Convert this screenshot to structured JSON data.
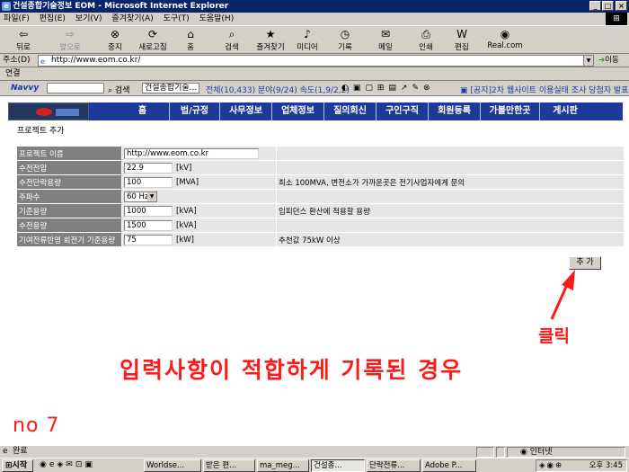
{
  "window": {
    "title": "건설종합기술정보 EOM - Microsoft Internet Explorer"
  },
  "menu": [
    "파일(F)",
    "편집(E)",
    "보기(V)",
    "즐겨찾기(A)",
    "도구(T)",
    "도움말(H)"
  ],
  "toolbar": [
    {
      "label": "뒤로",
      "icon": "back-arrow"
    },
    {
      "label": "앞으로",
      "icon": "forward-arrow"
    },
    {
      "label": "중지",
      "icon": "stop-icon"
    },
    {
      "label": "새로고침",
      "icon": "refresh-icon"
    },
    {
      "label": "홈",
      "icon": "home-icon"
    },
    {
      "label": "검색",
      "icon": "search-icon"
    },
    {
      "label": "즐겨찾기",
      "icon": "favorites-icon"
    },
    {
      "label": "미디어",
      "icon": "media-icon"
    },
    {
      "label": "기록",
      "icon": "history-icon"
    },
    {
      "label": "메일",
      "icon": "mail-icon"
    },
    {
      "label": "인쇄",
      "icon": "print-icon"
    },
    {
      "label": "편집",
      "icon": "edit-icon"
    },
    {
      "label": "Real.com",
      "icon": "real-icon"
    }
  ],
  "address": {
    "label": "주소(D)",
    "url": "http://www.eom.co.kr/",
    "go": "이동"
  },
  "links": {
    "label": "연결"
  },
  "navy": {
    "brand": "Navvy",
    "search_label": "검색",
    "query": "건설종합기술...",
    "results": "전체(10,433)  분야(9/24)  속도(1,9/2,2)",
    "ticker": "[공지]2차 웹사이트 이용실태 조사 당첨자 발표"
  },
  "site_nav": [
    "홈",
    "법/규정",
    "사무정보",
    "업체정보",
    "질의회신",
    "구인구직",
    "회원등록",
    "가볼만한곳",
    "게시판"
  ],
  "form": {
    "section_title": "프로젝트 추가",
    "rows": [
      {
        "label": "프로젝트 이름",
        "value": "http://www.eom.co.kr",
        "unit": "",
        "note": ""
      },
      {
        "label": "수전전압",
        "value": "22.9",
        "unit": "[kV]",
        "note": ""
      },
      {
        "label": "수전단락용량",
        "value": "100",
        "unit": "[MVA]",
        "note": "최소 100MVA, 변전소가 가까운곳은 전기사업자에게 문의"
      },
      {
        "label": "주파수",
        "value": "60 Hz",
        "unit": "",
        "note": ""
      },
      {
        "label": "기준용량",
        "value": "1000",
        "unit": "[kVA]",
        "note": "임피던스 환산에 적용할 용량"
      },
      {
        "label": "수전용량",
        "value": "1500",
        "unit": "[kVA]",
        "note": ""
      },
      {
        "label": "기여전류반영 회전기 기준용량",
        "value": "75",
        "unit": "[kW]",
        "note": "추천값 75kW 이상"
      }
    ],
    "add_button": "추 가"
  },
  "annotations": {
    "click": "클릭",
    "caption": "입력사항이 적합하게 기록된 경우",
    "number": "no 7",
    "color": "#ff1a1a"
  },
  "statusbar": {
    "text": "완료",
    "zone": "인터넷"
  },
  "taskbar": {
    "start": "시작",
    "tasks": [
      "Worldse...",
      "받은 편...",
      "ma_meg...",
      "건설종...",
      "단락전류...",
      "Adobe P..."
    ],
    "active_task": 3,
    "clock": "오후 3:45"
  }
}
